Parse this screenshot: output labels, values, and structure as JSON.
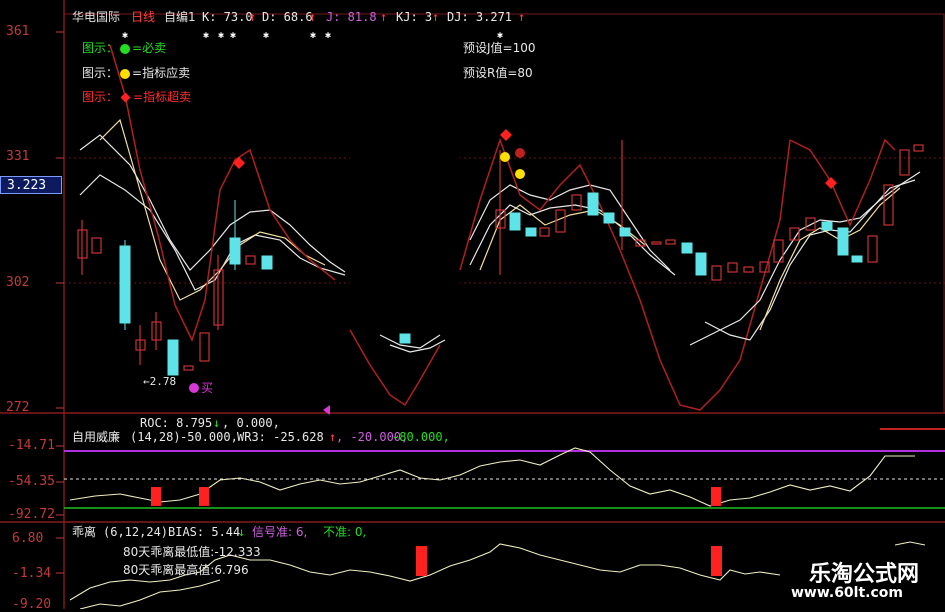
{
  "header": {
    "stock_name": "华电国际",
    "period": "日线",
    "indicator": "自编1",
    "k": "K: 73.0",
    "d": "D: 68.6",
    "j": "J: 81.8",
    "kj": "KJ: 3",
    "dj": "DJ: 3.271"
  },
  "legend": [
    {
      "prefix": "图示：",
      "text": "=必卖",
      "dot_color": "#22dd22",
      "shape": "circle"
    },
    {
      "prefix": "图示：",
      "text": "=指标应卖",
      "dot_color": "#ffe000",
      "shape": "circle"
    },
    {
      "prefix": "图示：",
      "text": "=指标超卖",
      "dot_color": "#ff2020",
      "shape": "diamond"
    }
  ],
  "presets": {
    "j": "预设J值=100",
    "r": "预设R值=80"
  },
  "price_axis": {
    "top": "361",
    "mid": "331",
    "current": "3.223",
    "low": "302",
    "bottom": "272"
  },
  "low_marker": {
    "value": "2.78",
    "buy_label": "买"
  },
  "panel2": {
    "roc_label": "ROC: 8.795",
    "roc_arrow": "↓",
    "roc_extra": ", 0.000,",
    "name": "自用威廉",
    "params": "(14,28)",
    "v1": "-50.000,",
    "wr3": "WR3: -25.628",
    "wr3_arrow": "↑",
    "v2": ", -20.000,",
    "v3": "-80.000,",
    "axis": [
      "-14.71",
      "-54.35",
      "-92.72"
    ]
  },
  "panel3": {
    "name": "乖离",
    "params": "(6,12,24)",
    "bias": "BIAS: 5.44",
    "bias_arrow": "↓",
    "signal": "信号准: 6,",
    "inaccurate": "不准: 0,",
    "low_note": "80天乖离最低值:-12.333",
    "high_note": "80天乖离最高值:6.796",
    "axis": [
      "6.80",
      "-1.34",
      "-9.20"
    ]
  },
  "watermark": {
    "title": "乐淘公式网",
    "url": "www.60lt.com"
  }
}
